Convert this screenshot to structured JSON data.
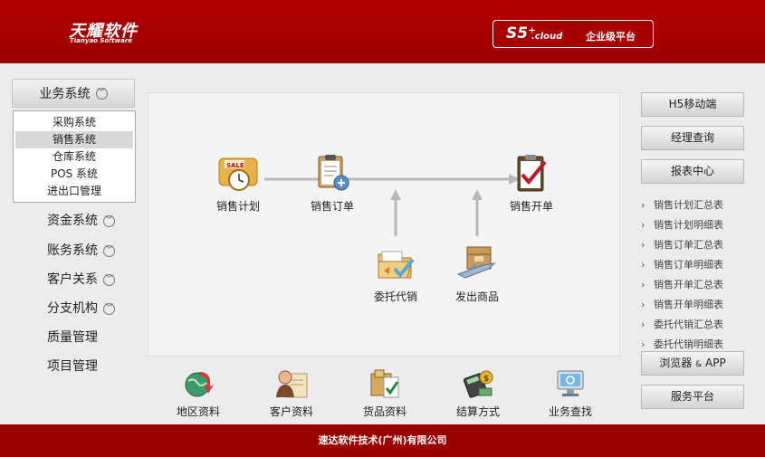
{
  "header": {
    "logo_cn": "天耀软件",
    "logo_en": "Tianyao Software",
    "badge_s5": "S5⁺",
    "badge_cloud": ".cloud",
    "badge_platform": "企业级平台"
  },
  "nav": {
    "active": "业务系统",
    "submenu": [
      "采购系统",
      "销售系统",
      "仓库系统",
      "POS 系统",
      "进出口管理"
    ],
    "submenu_selected": "销售系统",
    "items": [
      {
        "label": "资金系统",
        "chevron": true
      },
      {
        "label": "账务系统",
        "chevron": true
      },
      {
        "label": "客户关系",
        "chevron": true
      },
      {
        "label": "分支机构",
        "chevron": true
      },
      {
        "label": "质量管理",
        "chevron": false
      },
      {
        "label": "项目管理",
        "chevron": false
      }
    ]
  },
  "flow": {
    "nodes": [
      {
        "label": "销售计划",
        "icon": "sale-clock-icon"
      },
      {
        "label": "销售订单",
        "icon": "clipboard-add-icon"
      },
      {
        "label": "销售开单",
        "icon": "clipboard-check-icon"
      },
      {
        "label": "委托代销",
        "icon": "folder-check-icon"
      },
      {
        "label": "发出商品",
        "icon": "box-plane-icon"
      }
    ]
  },
  "bottom": [
    {
      "label": "地区资料",
      "icon": "globe-arrow-icon"
    },
    {
      "label": "客户资料",
      "icon": "person-card-icon"
    },
    {
      "label": "货品资料",
      "icon": "box-check-icon"
    },
    {
      "label": "结算方式",
      "icon": "calculator-money-icon"
    },
    {
      "label": "业务查找",
      "icon": "monitor-search-icon"
    }
  ],
  "right": {
    "buttons_top": [
      "H5移动端",
      "经理查询",
      "报表中心"
    ],
    "reports": [
      "销售计划汇总表",
      "销售计划明细表",
      "销售订单汇总表",
      "销售订单明细表",
      "销售开单汇总表",
      "销售开单明细表",
      "委托代销汇总表",
      "委托代销明细表"
    ],
    "browser_app": "浏览器",
    "browser_amp": "&",
    "browser_app2": "APP",
    "service": "服务平台"
  },
  "footer": {
    "text": "速达软件技术(广州)有限公司"
  },
  "colors": {
    "brand": "#b50000",
    "footer": "#9b0000"
  }
}
